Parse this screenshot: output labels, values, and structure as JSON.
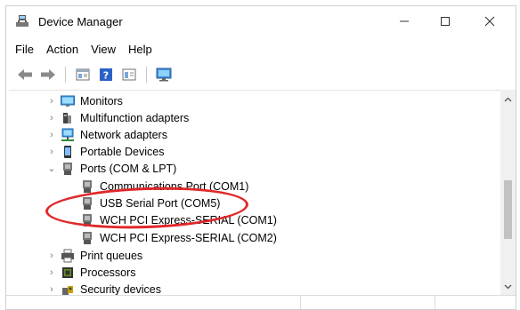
{
  "window": {
    "title": "Device Manager",
    "controls": {
      "minimize": "—",
      "maximize": "☐",
      "close": "✕"
    }
  },
  "menu": [
    "File",
    "Action",
    "View",
    "Help"
  ],
  "toolbar": [
    "back-icon",
    "forward-icon",
    "properties-icon",
    "help-icon",
    "view-icon",
    "monitor-icon"
  ],
  "tree": [
    {
      "label": "Monitors",
      "expander": "›",
      "icon": "monitor-icon",
      "level": 0
    },
    {
      "label": "Multifunction adapters",
      "expander": "›",
      "icon": "multifunction-icon",
      "level": 0
    },
    {
      "label": "Network adapters",
      "expander": "›",
      "icon": "network-icon",
      "level": 0
    },
    {
      "label": "Portable Devices",
      "expander": "›",
      "icon": "portable-device-icon",
      "level": 0
    },
    {
      "label": "Ports (COM & LPT)",
      "expander": "⌄",
      "icon": "port-icon",
      "level": 0
    },
    {
      "label": "Communications Port (COM1)",
      "expander": "",
      "icon": "port-icon",
      "level": 1
    },
    {
      "label": "USB Serial Port (COM5)",
      "expander": "",
      "icon": "port-icon",
      "level": 1
    },
    {
      "label": "WCH PCI Express-SERIAL (COM1)",
      "expander": "",
      "icon": "port-icon",
      "level": 1
    },
    {
      "label": "WCH PCI Express-SERIAL (COM2)",
      "expander": "",
      "icon": "port-icon",
      "level": 1
    },
    {
      "label": "Print queues",
      "expander": "›",
      "icon": "printer-icon",
      "level": 0
    },
    {
      "label": "Processors",
      "expander": "›",
      "icon": "processor-icon",
      "level": 0
    },
    {
      "label": "Security devices",
      "expander": "›",
      "icon": "security-icon",
      "level": 0
    }
  ],
  "scrollbar": {
    "up": "⌃",
    "down": "⌄"
  },
  "annotation": {
    "highlighted_item": "USB Serial Port (COM5)",
    "color": "#e0282a"
  }
}
